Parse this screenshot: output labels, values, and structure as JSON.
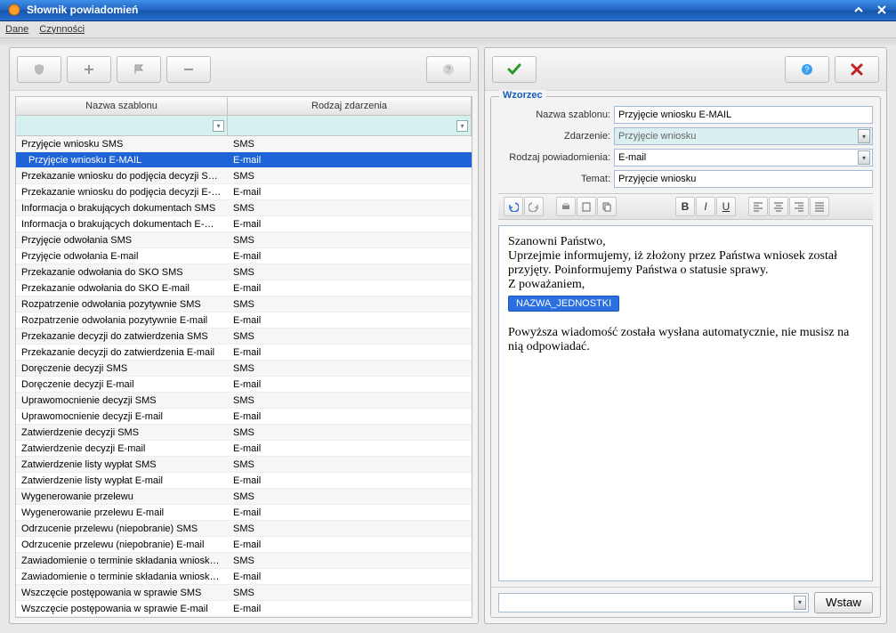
{
  "window": {
    "title": "Słownik powiadomień"
  },
  "menu": {
    "dane": "Dane",
    "czynnosci": "Czynności"
  },
  "grid": {
    "headers": {
      "name": "Nazwa szablonu",
      "type": "Rodzaj zdarzenia"
    },
    "rows": [
      {
        "name": "Przyjęcie wniosku SMS",
        "type": "SMS"
      },
      {
        "name": "Przyjęcie wniosku E-MAIL",
        "type": "E-mail"
      },
      {
        "name": "Przekazanie wniosku do podjęcia decyzji SMS",
        "type": "SMS"
      },
      {
        "name": "Przekazanie wniosku do podjęcia decyzji E-mail",
        "type": "E-mail"
      },
      {
        "name": "Informacja o brakujących dokumentach SMS",
        "type": "SMS"
      },
      {
        "name": "Informacja o brakujących dokumentach E-mail",
        "type": "E-mail"
      },
      {
        "name": "Przyjęcie odwołania SMS",
        "type": "SMS"
      },
      {
        "name": "Przyjęcie odwołania E-mail",
        "type": "E-mail"
      },
      {
        "name": "Przekazanie odwołania do SKO SMS",
        "type": "SMS"
      },
      {
        "name": "Przekazanie odwołania do SKO E-mail",
        "type": "E-mail"
      },
      {
        "name": "Rozpatrzenie odwołania pozytywnie SMS",
        "type": "SMS"
      },
      {
        "name": "Rozpatrzenie odwołania pozytywnie E-mail",
        "type": "E-mail"
      },
      {
        "name": "Przekazanie decyzji do zatwierdzenia SMS",
        "type": "SMS"
      },
      {
        "name": "Przekazanie decyzji do zatwierdzenia E-mail",
        "type": "E-mail"
      },
      {
        "name": "Doręczenie decyzji SMS",
        "type": "SMS"
      },
      {
        "name": "Doręczenie decyzji E-mail",
        "type": "E-mail"
      },
      {
        "name": "Uprawomocnienie decyzji SMS",
        "type": "SMS"
      },
      {
        "name": "Uprawomocnienie decyzji E-mail",
        "type": "E-mail"
      },
      {
        "name": "Zatwierdzenie decyzji SMS",
        "type": "SMS"
      },
      {
        "name": "Zatwierdzenie decyzji E-mail",
        "type": "E-mail"
      },
      {
        "name": "Zatwierdzenie listy wypłat SMS",
        "type": "SMS"
      },
      {
        "name": "Zatwierdzenie listy wypłat E-mail",
        "type": "E-mail"
      },
      {
        "name": "Wygenerowanie przelewu",
        "type": "SMS"
      },
      {
        "name": "Wygenerowanie przelewu E-mail",
        "type": "E-mail"
      },
      {
        "name": "Odrzucenie przelewu (niepobranie) SMS",
        "type": "SMS"
      },
      {
        "name": "Odrzucenie przelewu (niepobranie) E-mail",
        "type": "E-mail"
      },
      {
        "name": "Zawiadomienie o terminie składania wniosku SMS",
        "type": "SMS"
      },
      {
        "name": "Zawiadomienie o terminie składania wniosku E-...",
        "type": "E-mail"
      },
      {
        "name": "Wszczęcie postępowania w sprawie SMS",
        "type": "SMS"
      },
      {
        "name": "Wszczęcie postępowania w sprawie E-mail",
        "type": "E-mail"
      }
    ],
    "selectedIndex": 1
  },
  "form": {
    "legend": "Wzorzec",
    "labels": {
      "name": "Nazwa szablonu:",
      "event": "Zdarzenie:",
      "kind": "Rodzaj powiadomienia:",
      "subject": "Temat:"
    },
    "values": {
      "name": "Przyjęcie wniosku E-MAIL",
      "event": "Przyjęcie wniosku",
      "kind": "E-mail",
      "subject": "Przyjęcie wniosku"
    }
  },
  "editor": {
    "line1": "Szanowni Państwo,",
    "line2": "Uprzejmie informujemy, iż złożony przez Państwa wniosek został przyjęty. Poinformujemy Państwa o statusie sprawy.",
    "line3": "Z poważaniem,",
    "tag": "NAZWA_JEDNOSTKI",
    "footer": "Powyższa wiadomość została wysłana automatycznie, nie musisz na nią odpowiadać."
  },
  "bottom": {
    "insert": "Wstaw"
  }
}
